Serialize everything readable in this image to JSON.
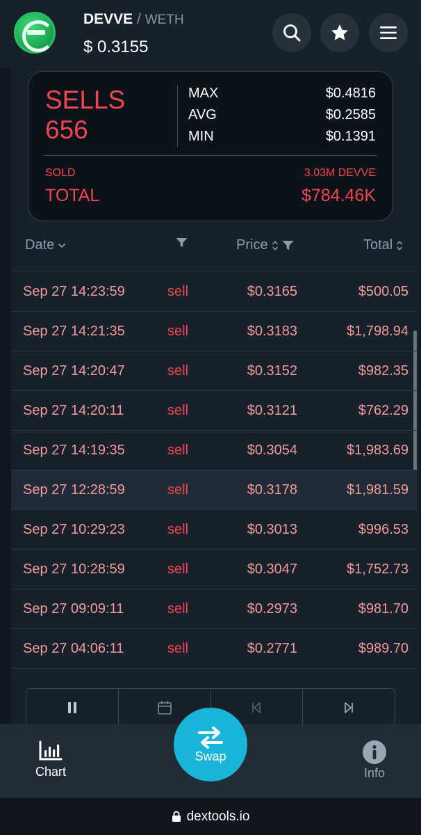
{
  "header": {
    "base_token": "DEVVE",
    "separator": "/",
    "quote_token": "WETH",
    "price": "$ 0.3155"
  },
  "summary": {
    "title": "SELLS",
    "count": "656",
    "max_label": "MAX",
    "max_value": "$0.4816",
    "avg_label": "AVG",
    "avg_value": "$0.2585",
    "min_label": "MIN",
    "min_value": "$0.1391",
    "sold_label": "SOLD",
    "sold_amount": "3.03M DEVVE",
    "total_label": "TOTAL",
    "total_value": "$784.46K"
  },
  "table": {
    "columns": {
      "date": "Date",
      "price": "Price",
      "total": "Total"
    },
    "rows": [
      {
        "date": "Sep 27 14:23:59",
        "type": "sell",
        "price": "$0.3165",
        "total": "$500.05"
      },
      {
        "date": "Sep 27 14:21:35",
        "type": "sell",
        "price": "$0.3183",
        "total": "$1,798.94"
      },
      {
        "date": "Sep 27 14:20:47",
        "type": "sell",
        "price": "$0.3152",
        "total": "$982.35"
      },
      {
        "date": "Sep 27 14:20:11",
        "type": "sell",
        "price": "$0.3121",
        "total": "$762.29"
      },
      {
        "date": "Sep 27 14:19:35",
        "type": "sell",
        "price": "$0.3054",
        "total": "$1,983.69"
      },
      {
        "date": "Sep 27 12:28:59",
        "type": "sell",
        "price": "$0.3178",
        "total": "$1,981.59"
      },
      {
        "date": "Sep 27 10:29:23",
        "type": "sell",
        "price": "$0.3013",
        "total": "$996.53"
      },
      {
        "date": "Sep 27 10:28:59",
        "type": "sell",
        "price": "$0.3047",
        "total": "$1,752.73"
      },
      {
        "date": "Sep 27 09:09:11",
        "type": "sell",
        "price": "$0.2973",
        "total": "$981.70"
      },
      {
        "date": "Sep 27 04:06:11",
        "type": "sell",
        "price": "$0.2771",
        "total": "$989.70"
      }
    ]
  },
  "controls": [
    "pause-icon",
    "calendar-icon",
    "skip-back-icon",
    "skip-forward-icon"
  ],
  "nav": {
    "chart_label": "Chart",
    "swap_label": "Swap",
    "info_label": "Info"
  },
  "browser": {
    "url": "dextools.io"
  },
  "colors": {
    "sell": "#f04652",
    "accent": "#18b5d8",
    "logo": "#1fa956"
  }
}
